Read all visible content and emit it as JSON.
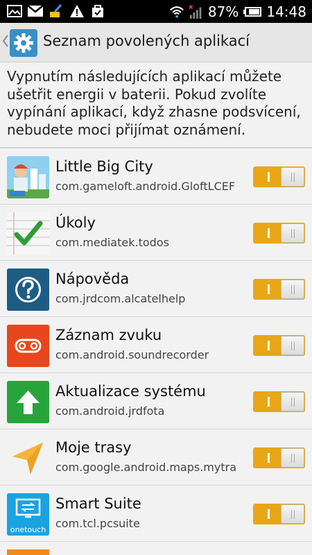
{
  "status_bar": {
    "battery_percent": "87%",
    "time": "14:48",
    "icons": [
      "gallery-icon",
      "gmail-icon",
      "cleaner-icon",
      "warning-icon",
      "bag-check-icon",
      "wifi-icon",
      "signal-icon",
      "battery-icon"
    ]
  },
  "action_bar": {
    "title": "Seznam povolených aplikací",
    "icon": "settings-gear-icon"
  },
  "description": "Vypnutím následujících aplikací můžete ušetřit energii v baterii. Pokud zvolíte vypínání aplikací, když zhasne podsvícení, nebudete moci přijímat oznámení.",
  "apps": [
    {
      "name": "Little Big City",
      "package": "com.gameloft.android.GloftLCEF",
      "icon": "little-big-city-icon",
      "enabled": true
    },
    {
      "name": "Úkoly",
      "package": "com.mediatek.todos",
      "icon": "todos-checkmark-icon",
      "enabled": true
    },
    {
      "name": "Nápověda",
      "package": "com.jrdcom.alcatelhelp",
      "icon": "help-question-icon",
      "enabled": true
    },
    {
      "name": "Záznam zvuku",
      "package": "com.android.soundrecorder",
      "icon": "sound-recorder-icon",
      "enabled": true
    },
    {
      "name": "Aktualizace systému",
      "package": "com.android.jrdfota",
      "icon": "system-update-arrow-icon",
      "enabled": true
    },
    {
      "name": "Moje trasy",
      "package": "com.google.android.maps.mytra",
      "icon": "navigation-arrow-icon",
      "enabled": true
    },
    {
      "name": "Smart Suite",
      "package": "com.tcl.pcsuite",
      "icon": "smart-suite-icon",
      "icon_caption": "onetouch",
      "enabled": true
    }
  ],
  "colors": {
    "accent": "#e8a717",
    "actionbar_bg": "#e6e6e6",
    "page_bg": "#f2f2f2"
  }
}
